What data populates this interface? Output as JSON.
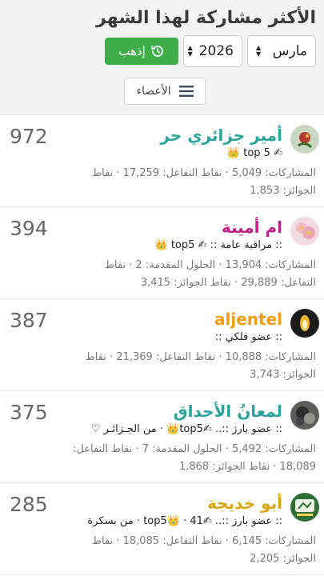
{
  "page": {
    "title": "الأكثر مشاركة لهذا الشهر",
    "month": "مارس",
    "year": "2026",
    "go_label": "إذهب",
    "members_label": "الأعضاء"
  },
  "colors": {
    "go_button": "#3fae49",
    "name_teal": "#2aa39a",
    "name_magenta": "#c0208a",
    "name_orange": "#f09d14",
    "name_gold": "#d9a410"
  },
  "members": [
    {
      "name": "أمير جزائري حر",
      "score": "972",
      "rank": "✍ top 5 👑",
      "stats_line1": "المشاركات: 5,049 · نقاط التفاعل: 17,259 · نقاط",
      "stats_line2": "الجوائز: 1,853"
    },
    {
      "name": "ام أمينة",
      "score": "394",
      "rank": ":: مراقبة عامة :: ✍ top5 👑",
      "stats_line1": "المشاركات: 13,904 · الحلول المقدمة: 2 · نقاط",
      "stats_line2": "التفاعل: 29,889 · نقاط الجوائز: 3,415"
    },
    {
      "name": "aljentel",
      "score": "387",
      "rank": ":: عضو فلكي ::",
      "stats_line1": "المشاركات: 10,888 · نقاط التفاعل: 21,369 · نقاط",
      "stats_line2": "الجوائز: 3,743"
    },
    {
      "name": "لمعانُ الأحداق",
      "score": "375",
      "rank": ":: عضو بارز ::.. ✍top5👑 · من الجـزائـر ♡",
      "stats_line1": "المشاركات: 5,492 · الحلول المقدمة: 7 · نقاط التفاعل:",
      "stats_line2": "18,089 · نقاط الجوائز: 1,868"
    },
    {
      "name": "أبو خديجة",
      "score": "285",
      "rank": ":: عضو بارز ::.. ✍top5👑 · 41 · من بسكرة",
      "stats_line1": "المشاركات: 6,145 · نقاط التفاعل: 18,085 · نقاط",
      "stats_line2": "الجوائز: 2,205"
    }
  ]
}
